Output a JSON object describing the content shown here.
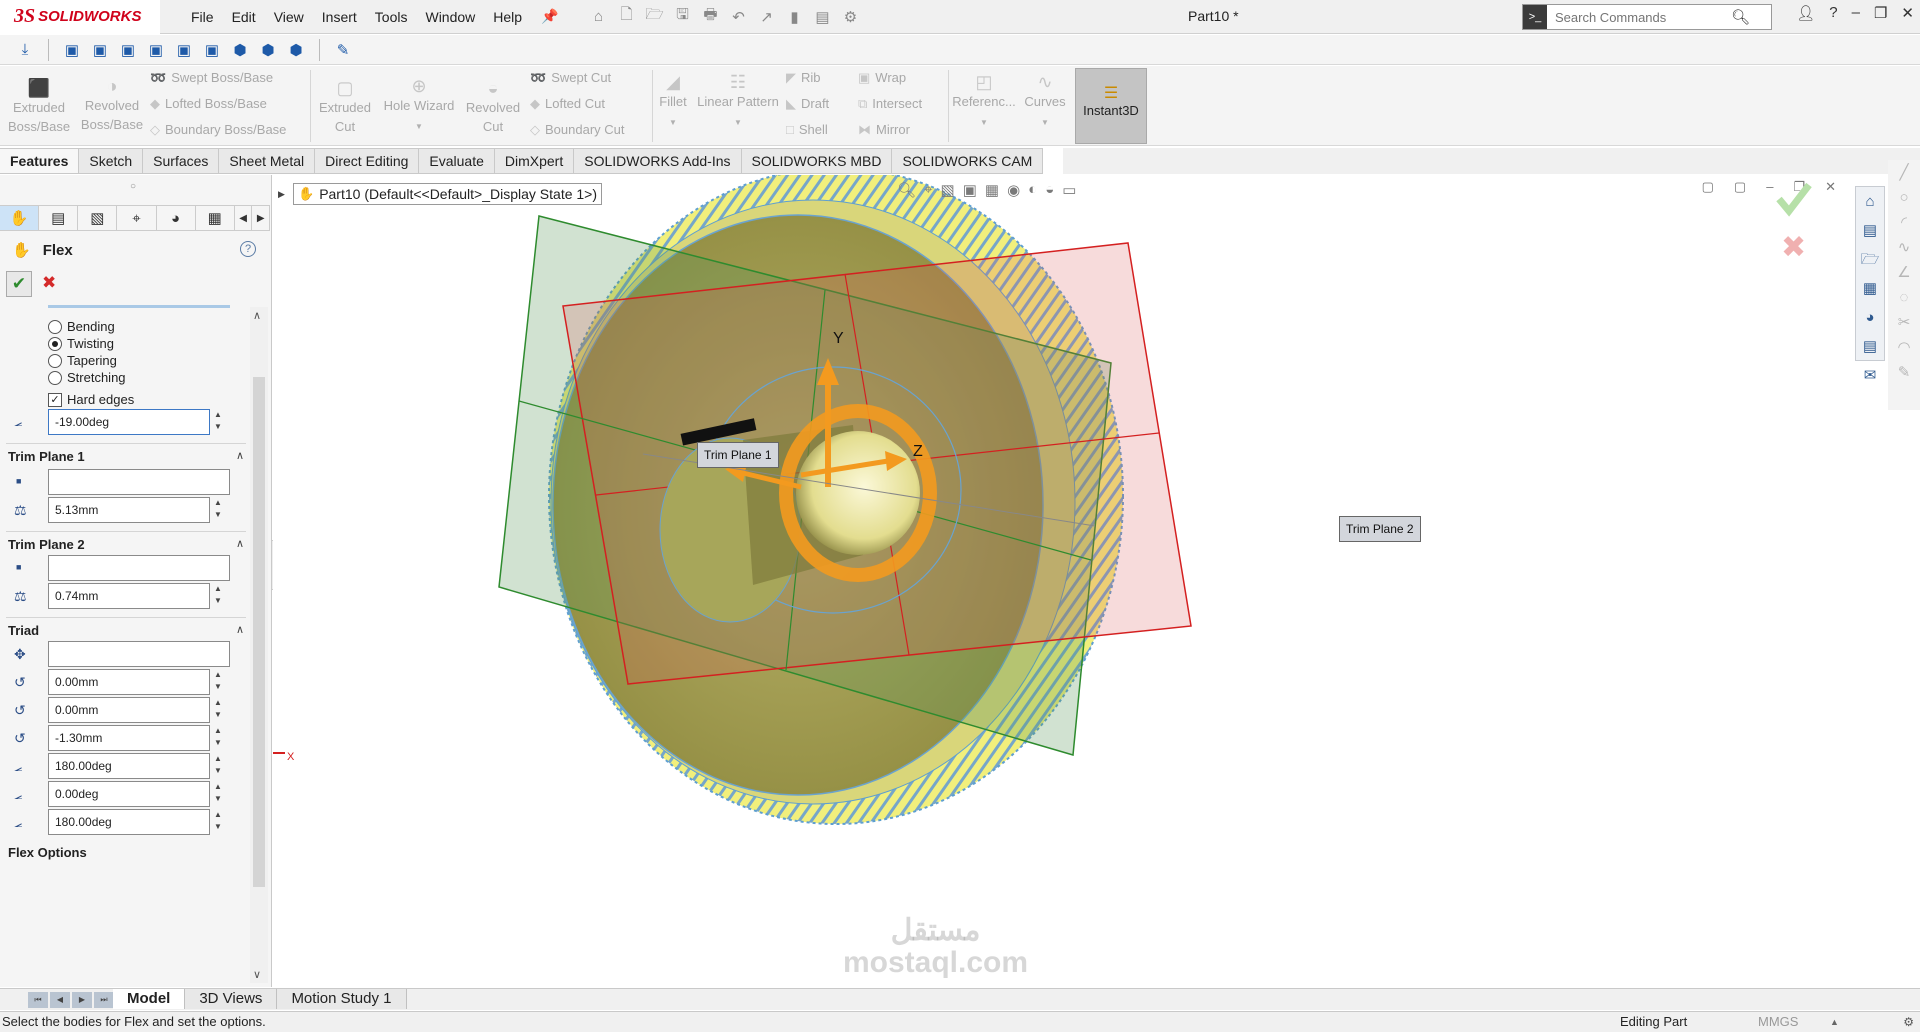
{
  "app": {
    "brand_ds": "3S",
    "brand_name": "SOLIDWORKS",
    "menus": [
      "File",
      "Edit",
      "View",
      "Insert",
      "Tools",
      "Window",
      "Help"
    ],
    "document_title": "Part10 *",
    "search_placeholder": "Search Commands"
  },
  "ribbon": {
    "extruded_boss": [
      "Extruded",
      "Boss/Base"
    ],
    "revolved_boss": [
      "Revolved",
      "Boss/Base"
    ],
    "swept_boss": "Swept Boss/Base",
    "lofted_boss": "Lofted Boss/Base",
    "boundary_boss": "Boundary Boss/Base",
    "extruded_cut": [
      "Extruded",
      "Cut"
    ],
    "hole_wizard": "Hole Wizard",
    "revolved_cut": [
      "Revolved",
      "Cut"
    ],
    "swept_cut": "Swept Cut",
    "lofted_cut": "Lofted Cut",
    "boundary_cut": "Boundary Cut",
    "fillet": "Fillet",
    "linear_pattern": "Linear Pattern",
    "rib": "Rib",
    "draft": "Draft",
    "shell": "Shell",
    "wrap": "Wrap",
    "intersect": "Intersect",
    "mirror": "Mirror",
    "reference": "Referenc...",
    "curves": "Curves",
    "instant3d": "Instant3D"
  },
  "tabs": [
    "Features",
    "Sketch",
    "Surfaces",
    "Sheet Metal",
    "Direct Editing",
    "Evaluate",
    "DimXpert",
    "SOLIDWORKS Add-Ins",
    "SOLIDWORKS MBD",
    "SOLIDWORKS CAM"
  ],
  "property_manager": {
    "title": "Flex",
    "modes": [
      "Bending",
      "Twisting",
      "Tapering",
      "Stretching"
    ],
    "selected_mode": "Twisting",
    "hard_edges_label": "Hard edges",
    "hard_edges_checked": true,
    "angle": "-19.00deg",
    "trim_plane_1": {
      "label": "Trim Plane 1",
      "offset": "5.13mm"
    },
    "trim_plane_2": {
      "label": "Trim Plane 2",
      "offset": "0.74mm"
    },
    "triad": {
      "label": "Triad",
      "x": "0.00mm",
      "y": "0.00mm",
      "z": "-1.30mm",
      "rot_x": "180.00deg",
      "rot_y": "0.00deg",
      "rot_z": "180.00deg"
    },
    "flex_options_label": "Flex Options"
  },
  "viewport": {
    "breadcrumb": "Part10  (Default<<Default>_Display State 1>)",
    "callout_trim1": "Trim Plane 1",
    "callout_trim2": "Trim Plane 2",
    "axis_x": "X",
    "axis_y": "Y",
    "axis_z": "Z",
    "watermark_arabic": "مستقل",
    "watermark_latin": "mostaql.com"
  },
  "bottom_tabs": [
    "Model",
    "3D Views",
    "Motion Study 1"
  ],
  "status": {
    "message": "Select the bodies for Flex and set the options.",
    "mode": "Editing Part",
    "units": "MMGS"
  }
}
